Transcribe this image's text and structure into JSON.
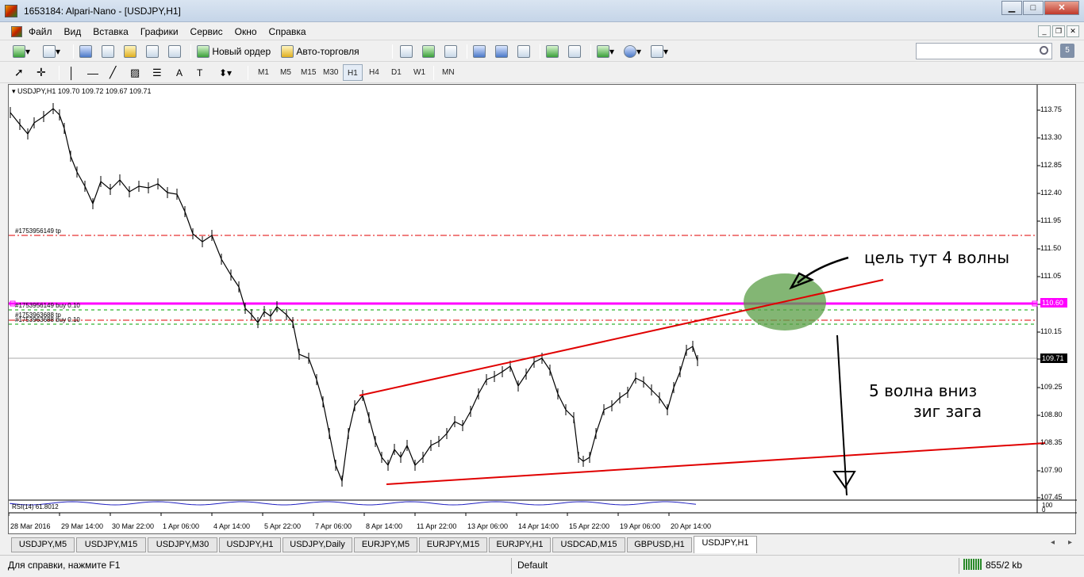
{
  "window": {
    "title": "1653184: Alpari-Nano - [USDJPY,H1]"
  },
  "menu": {
    "items": [
      "Файл",
      "Вид",
      "Вставка",
      "Графики",
      "Сервис",
      "Окно",
      "Справка"
    ]
  },
  "toolbar": {
    "new_order_label": "Новый ордер",
    "auto_trading_label": "Авто-торговля",
    "timeframes": [
      "M1",
      "M5",
      "M15",
      "M30",
      "H1",
      "H4",
      "D1",
      "W1",
      "MN"
    ],
    "active_timeframe": "H1",
    "search": {
      "value": ""
    }
  },
  "chart": {
    "symbol_line": "USDJPY,H1  109.70 109.72 109.67 109.71",
    "indicator_label": "RSI(14) 61.8012",
    "indicator_scale": {
      "max": "100",
      "min": "0"
    },
    "y_ticks": [
      "113.75",
      "113.30",
      "112.85",
      "112.40",
      "111.95",
      "111.50",
      "111.05",
      "110.60",
      "110.15",
      "109.71",
      "109.25",
      "108.80",
      "108.35",
      "107.90",
      "107.45"
    ],
    "x_ticks": [
      "28 Mar 2016",
      "29 Mar 14:00",
      "30 Mar 22:00",
      "1 Apr 06:00",
      "4 Apr 14:00",
      "5 Apr 22:00",
      "7 Apr 06:00",
      "8 Apr 14:00",
      "11 Apr 22:00",
      "13 Apr 06:00",
      "14 Apr 14:00",
      "15 Apr 22:00",
      "19 Apr 06:00",
      "20 Apr 14:00"
    ],
    "current_price": "109.71",
    "alert_price": "110.60",
    "order_labels": [
      "#1753956149 tp",
      "#1753956149 buy 0.10",
      "#1753963688 tp",
      "#1753963688 buy 0.10"
    ],
    "annotations": [
      "цель тут 4 волны",
      "5 волна вниз",
      "зиг зага"
    ],
    "colors": {
      "alert_line": "#ff00ff",
      "trendline": "#e00000",
      "target_circle": "#5a9e46",
      "tp_line": "#e00000",
      "buy_line": "#00a000"
    }
  },
  "tabs": {
    "items": [
      "USDJPY,M5",
      "USDJPY,M15",
      "USDJPY,M30",
      "USDJPY,H1",
      "USDJPY,Daily",
      "EURJPY,M5",
      "EURJPY,M15",
      "EURJPY,H1",
      "USDCAD,M15",
      "GBPUSD,H1",
      "USDJPY,H1"
    ],
    "active_index": 10
  },
  "status": {
    "help": "Для справки, нажмите F1",
    "profile": "Default",
    "traffic": "855/2 kb"
  }
}
